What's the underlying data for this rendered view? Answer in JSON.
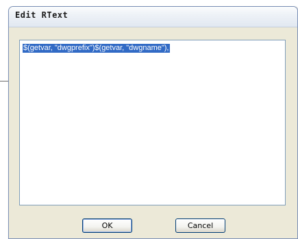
{
  "dialog": {
    "title": "Edit RText",
    "content": "$(getvar, \"dwgprefix\")$(getvar, \"dwgname\"),",
    "ok_label": "OK",
    "cancel_label": "Cancel"
  }
}
